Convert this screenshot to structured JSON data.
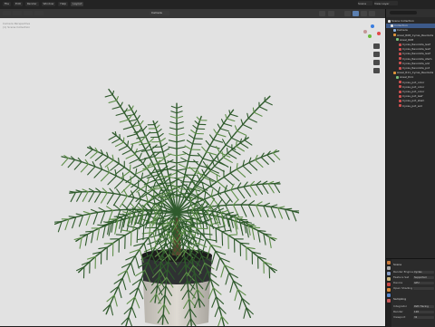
{
  "header": {
    "menu": [
      "File",
      "Edit",
      "Render",
      "Window",
      "Help"
    ],
    "workspace_tabs": [
      "Layout"
    ],
    "scene": "Scene",
    "view_layer": "View Layer"
  },
  "viewport": {
    "camera_label": "Camera",
    "info_lines": [
      "Camera Perspective",
      "(1) Scene Collection"
    ]
  },
  "outliner": {
    "rows": [
      {
        "label": "Scene Collection",
        "indent": 0,
        "icon": "collection-icon",
        "selected": false
      },
      {
        "label": "Collection",
        "indent": 1,
        "icon": "collection-icon",
        "selected": true
      },
      {
        "label": "Camera",
        "indent": 2,
        "icon": "camera-icon",
        "selected": false
      },
      {
        "label": "Areal_R08_Cycas_Revoluta",
        "indent": 2,
        "icon": "object-icon",
        "selected": false
      },
      {
        "label": "Areal_R08",
        "indent": 3,
        "icon": "mesh-icon",
        "selected": false
      },
      {
        "label": "Cycas_Revoluta_leaf",
        "indent": 4,
        "icon": "material-icon",
        "selected": false
      },
      {
        "label": "Cycas_Revoluta_leaf",
        "indent": 4,
        "icon": "material-icon",
        "selected": false
      },
      {
        "label": "Cycas_Revoluta_leaf",
        "indent": 4,
        "icon": "material-icon",
        "selected": false
      },
      {
        "label": "Cycas_Revoluta_stem",
        "indent": 4,
        "icon": "material-icon",
        "selected": false
      },
      {
        "label": "Cycas_Revoluta_soil",
        "indent": 4,
        "icon": "material-icon",
        "selected": false
      },
      {
        "label": "Cycas_Revoluta_pot",
        "indent": 4,
        "icon": "material-icon",
        "selected": false
      },
      {
        "label": "Areal_R11_Cycas_Revoluta",
        "indent": 2,
        "icon": "object-icon",
        "selected": false
      },
      {
        "label": "Areal_R11",
        "indent": 3,
        "icon": "mesh-icon",
        "selected": false
      },
      {
        "label": "Cycas_pot_color",
        "indent": 4,
        "icon": "material-icon",
        "selected": false
      },
      {
        "label": "Cycas_pot_color",
        "indent": 4,
        "icon": "material-icon",
        "selected": false
      },
      {
        "label": "Cycas_pot_color",
        "indent": 4,
        "icon": "material-icon",
        "selected": false
      },
      {
        "label": "Cycas_pot_leaf",
        "indent": 4,
        "icon": "material-icon",
        "selected": false
      },
      {
        "label": "Cycas_pot_stem",
        "indent": 4,
        "icon": "material-icon",
        "selected": false
      },
      {
        "label": "Cycas_pot_soil",
        "indent": 4,
        "icon": "material-icon",
        "selected": false
      }
    ]
  },
  "properties": {
    "section": "Scene",
    "rows": [
      {
        "label": "Render Engine",
        "value": "Cycles"
      },
      {
        "label": "Feature Set",
        "value": "Supported"
      },
      {
        "label": "Device",
        "value": "GPU"
      },
      {
        "label": "Open Shading Language",
        "value": ""
      }
    ],
    "sampling_section": "Sampling",
    "sampling_rows": [
      {
        "label": "Integrator",
        "value": "Path Tracing"
      },
      {
        "label": "Render",
        "value": "128"
      },
      {
        "label": "Viewport",
        "value": "32"
      }
    ]
  },
  "colors": {
    "viewport_bg": "#e2e2e2",
    "selection": "#3d5a8a",
    "leaf_dark": "#2f5a2c",
    "leaf_light": "#5f8f4a",
    "pot_top": "#2f3133",
    "pot_base": "#cfcac3"
  }
}
